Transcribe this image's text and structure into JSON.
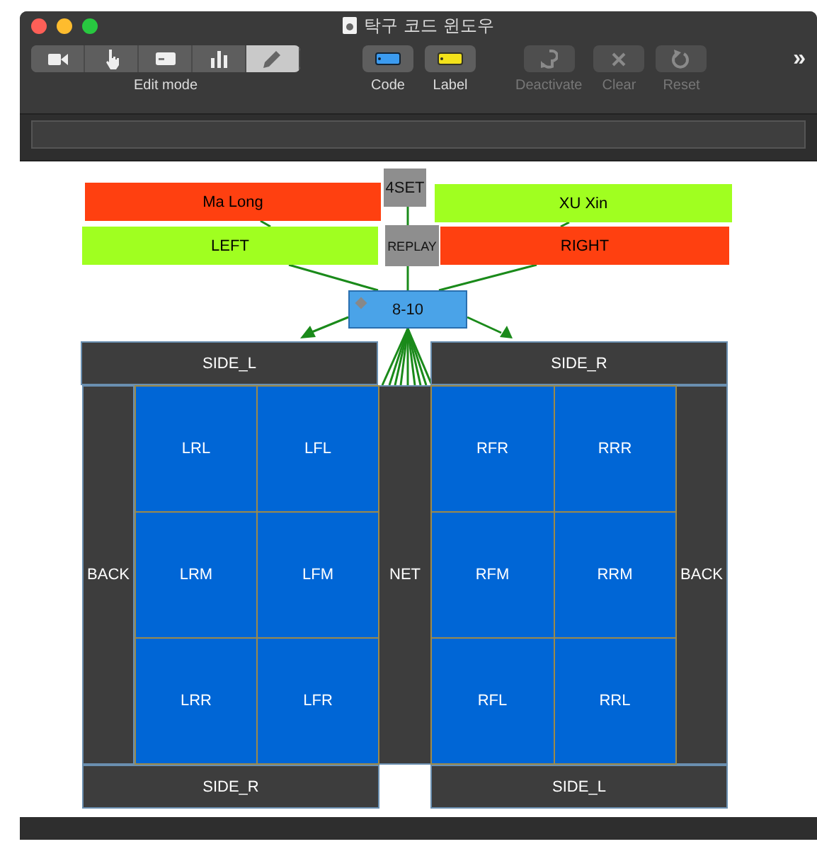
{
  "window": {
    "title": "탁구 코드 윈도우"
  },
  "toolbar": {
    "edit_mode": {
      "label": "Edit mode",
      "segments": [
        {
          "kind": "camera",
          "selected": false
        },
        {
          "kind": "pointer",
          "selected": false
        },
        {
          "kind": "card",
          "selected": false
        },
        {
          "kind": "chart",
          "selected": false
        },
        {
          "kind": "pencil",
          "selected": true
        }
      ]
    },
    "buttons": [
      {
        "kind": "code",
        "label": "Code",
        "disabled": false
      },
      {
        "kind": "label",
        "label": "Label",
        "disabled": false
      },
      {
        "kind": "deactivate",
        "label": "Deactivate",
        "disabled": true
      },
      {
        "kind": "clear",
        "label": "Clear",
        "disabled": true
      },
      {
        "kind": "reset",
        "label": "Reset",
        "disabled": true
      }
    ],
    "overflow": "»"
  },
  "diagram": {
    "set_node": "4SET",
    "replay_node": "REPLAY",
    "score_node": "8-10",
    "players": [
      {
        "name": "Ma Long",
        "color": "#ff4010"
      },
      {
        "name": "XU Xin",
        "color": "#a0ff20"
      }
    ],
    "sides": [
      {
        "name": "LEFT",
        "color": "#a0ff20"
      },
      {
        "name": "RIGHT",
        "color": "#ff4010"
      }
    ],
    "court": {
      "top_sides": [
        "SIDE_L",
        "SIDE_R"
      ],
      "back_labels": [
        "BACK",
        "BACK"
      ],
      "net": "NET",
      "left_zones": [
        "LRL",
        "LFL",
        "LRM",
        "LFM",
        "LRR",
        "LFR"
      ],
      "right_zones": [
        "RFR",
        "RRR",
        "RFM",
        "RRM",
        "RFL",
        "RRL"
      ],
      "bottom_sides": [
        "SIDE_R",
        "SIDE_L"
      ]
    }
  }
}
